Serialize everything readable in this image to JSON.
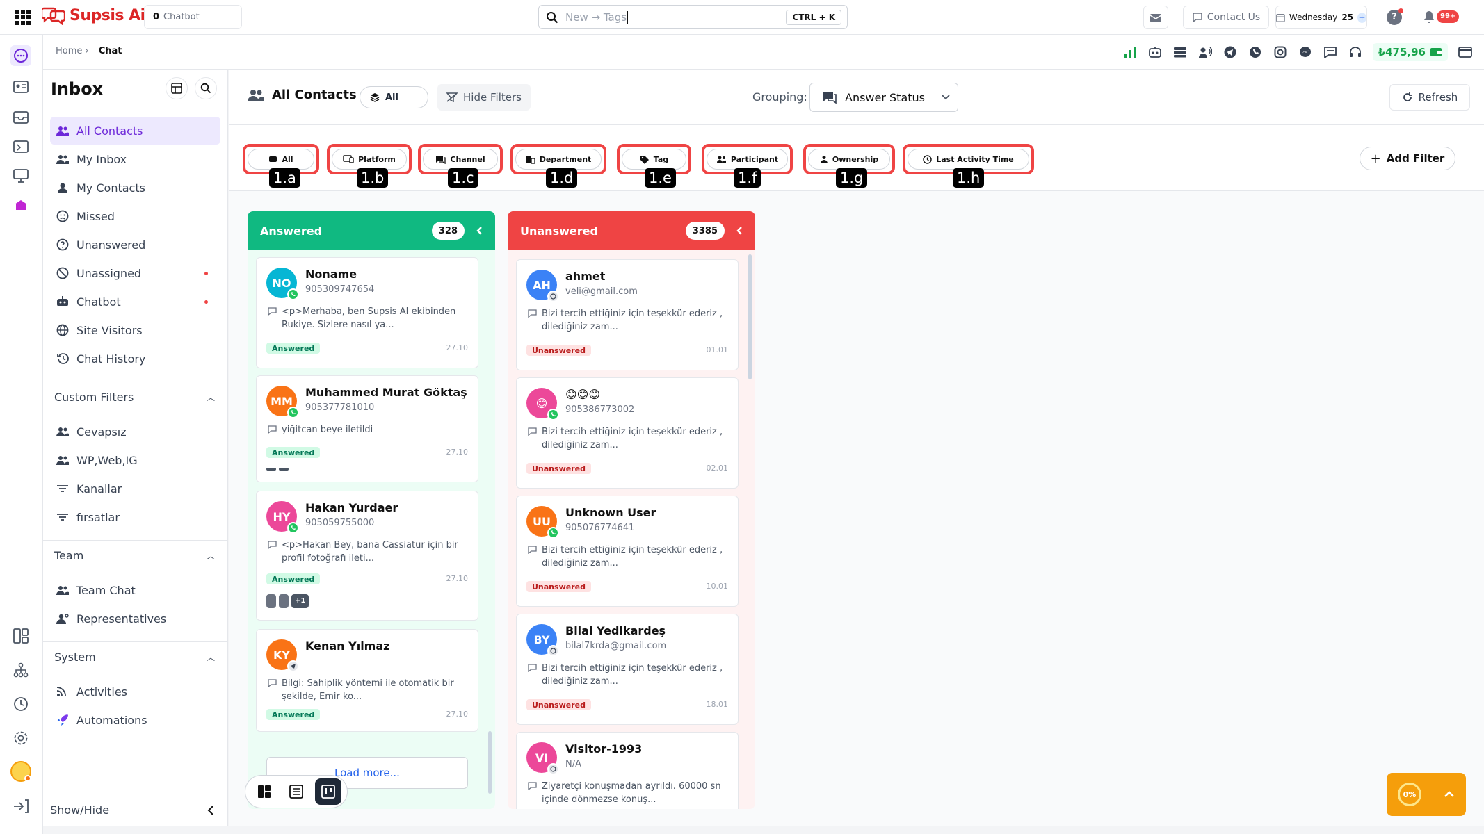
{
  "app": {
    "brand": "Supsis Ai",
    "brand_color": "#dc2626",
    "accent": "#6d28d9"
  },
  "topbar": {
    "chatbot_count": "0",
    "chatbot_label": "Chatbot",
    "search_placeholder": "New → Tags",
    "shortcut": "CTRL + K",
    "contact_us": "Contact Us",
    "date": "Wednesday",
    "date_day": "25",
    "notif_badge": "99+"
  },
  "breadcrumb": {
    "home": "Home ›",
    "current": "Chat"
  },
  "balance": "₺475,96",
  "sidebar": {
    "title": "Inbox",
    "items": [
      {
        "label": "All Contacts",
        "icon": "users-icon",
        "active": true
      },
      {
        "label": "My Inbox",
        "icon": "users-icon"
      },
      {
        "label": "My Contacts",
        "icon": "user-icon"
      },
      {
        "label": "Missed",
        "icon": "sad-face-icon"
      },
      {
        "label": "Unanswered",
        "icon": "question-icon"
      },
      {
        "label": "Unassigned",
        "icon": "block-icon",
        "dot": true
      },
      {
        "label": "Chatbot",
        "icon": "robot-icon",
        "dot": true
      },
      {
        "label": "Site Visitors",
        "icon": "globe-icon"
      },
      {
        "label": "Chat History",
        "icon": "history-icon"
      }
    ],
    "custom_filters": {
      "title": "Custom Filters",
      "items": [
        "Cevapsız",
        "WP,Web,IG",
        "Kanallar",
        "fırsatlar"
      ]
    },
    "team": {
      "title": "Team",
      "items": [
        "Team Chat",
        "Representatives"
      ]
    },
    "system": {
      "title": "System",
      "items": [
        "Activities",
        "Automations"
      ]
    },
    "show_hide": "Show/Hide"
  },
  "main": {
    "title": "All Contacts",
    "all_pill": "All",
    "hide_filters": "Hide Filters",
    "grouping_label": "Grouping:",
    "grouping_value": "Answer Status",
    "refresh": "Refresh",
    "add_filter": "Add Filter",
    "filters": [
      {
        "label": "All",
        "badge": "1.a"
      },
      {
        "label": "Platform",
        "badge": "1.b"
      },
      {
        "label": "Channel",
        "badge": "1.c"
      },
      {
        "label": "Department",
        "badge": "1.d"
      },
      {
        "label": "Tag",
        "badge": "1.e"
      },
      {
        "label": "Participant",
        "badge": "1.f"
      },
      {
        "label": "Ownership",
        "badge": "1.g"
      },
      {
        "label": "Last Activity Time",
        "badge": "1.h"
      }
    ]
  },
  "columns": {
    "answered": {
      "title": "Answered",
      "count": "328",
      "color": "#10b981",
      "load_more": "Load more...",
      "cards": [
        {
          "initials": "NO",
          "name": "Noname",
          "sub": "905309747654",
          "msg": "<p>Merhaba, ben Supsis AI ekibinden Rukiye. Sizlere nasıl ya...",
          "status": "Answered",
          "date": "27.10",
          "color": "#06b6d4"
        },
        {
          "initials": "MM",
          "name": "Muhammed Murat Göktaş",
          "sub": "905377781010",
          "msg": "yiğitcan beye iletildi",
          "status": "Answered",
          "date": "27.10",
          "color": "#f97316"
        },
        {
          "initials": "HY",
          "name": "Hakan Yurdaer",
          "sub": "905059755000",
          "msg": "<p>Hakan Bey, bana Cassiatur için bir profil fotoğrafı ileti...",
          "status": "Answered",
          "date": "27.10",
          "color": "#ec4899",
          "extra": "+1"
        },
        {
          "initials": "KY",
          "name": "Kenan Yılmaz",
          "sub": "",
          "msg": "Bilgi: Sahiplik yöntemi ile otomatik bir şekilde, Emir ko...",
          "status": "Answered",
          "date": "27.10",
          "color": "#f97316"
        }
      ]
    },
    "unanswered": {
      "title": "Unanswered",
      "count": "3385",
      "color": "#ef4444",
      "cards": [
        {
          "initials": "AH",
          "name": "ahmet",
          "sub": "veli@gmail.com",
          "msg": "Bizi tercih ettiğiniz için teşekkür ederiz , dilediğiniz zam...",
          "status": "Unanswered",
          "date": "01.01",
          "color": "#3b82f6"
        },
        {
          "initials": "😊",
          "name": "😊😊😊",
          "sub": "905386773002",
          "msg": "Bizi tercih ettiğiniz için teşekkür ederiz , dilediğiniz zam...",
          "status": "Unanswered",
          "date": "02.01",
          "color": "#ec4899"
        },
        {
          "initials": "UU",
          "name": "Unknown User",
          "sub": "905076774641",
          "msg": "Bizi tercih ettiğiniz için teşekkür ederiz , dilediğiniz zam...",
          "status": "Unanswered",
          "date": "10.01",
          "color": "#f97316"
        },
        {
          "initials": "BY",
          "name": "Bilal Yedikardeş",
          "sub": "bilal7krda@gmail.com",
          "msg": "Bizi tercih ettiğiniz için teşekkür ederiz , dilediğiniz zam...",
          "status": "Unanswered",
          "date": "18.01",
          "color": "#3b82f6"
        },
        {
          "initials": "VI",
          "name": "Visitor-1993",
          "sub": "N/A",
          "msg": "Ziyaretçi konuşmadan ayrıldı. 60000 sn içinde dönmezse konuş...",
          "status": "",
          "date": "",
          "color": "#ec4899"
        }
      ]
    }
  },
  "progress": {
    "value": "0%"
  }
}
